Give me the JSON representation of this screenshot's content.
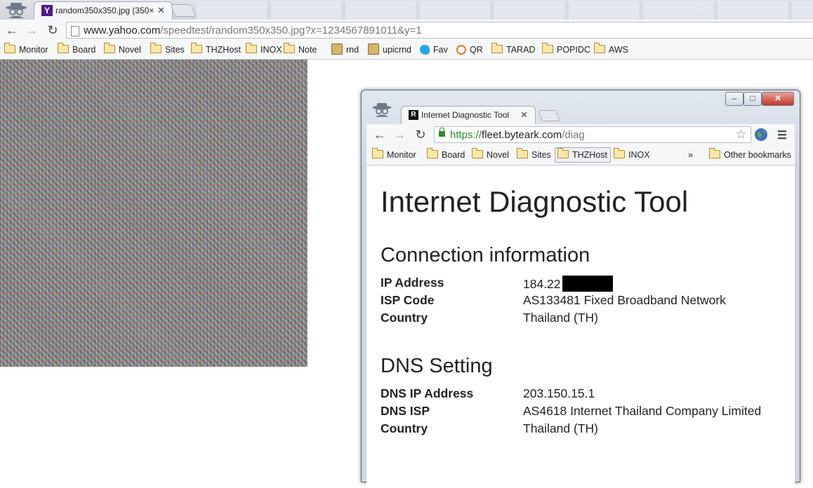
{
  "outer": {
    "tab": {
      "title": "random350x350.jpg (350×",
      "favicon": "Y"
    },
    "url": {
      "domain": "www.yahoo.com",
      "rest": "/speedtest/random350x350.jpg?x=1234567891011&y=1"
    },
    "bookmarks": [
      {
        "label": "Monitor",
        "icon": "folder-icon"
      },
      {
        "label": "Board",
        "icon": "folder-icon"
      },
      {
        "label": "Novel",
        "icon": "folder-icon"
      },
      {
        "label": "Sites",
        "icon": "folder-icon"
      },
      {
        "label": "THZHost",
        "icon": "folder-icon"
      },
      {
        "label": "INOX",
        "icon": "folder-icon"
      },
      {
        "label": "Note",
        "icon": "folder-icon"
      },
      {
        "label": "rnd",
        "icon": "page-icon"
      },
      {
        "label": "upicrnd",
        "icon": "page-icon"
      },
      {
        "label": "Fav",
        "icon": "twitter-icon"
      },
      {
        "label": "QR",
        "icon": "qr-icon"
      },
      {
        "label": "TARAD",
        "icon": "folder-icon"
      },
      {
        "label": "POPIDC",
        "icon": "folder-icon"
      },
      {
        "label": "AWS",
        "icon": "folder-icon"
      }
    ]
  },
  "inner": {
    "window_controls": {
      "minimize": "–",
      "maximize": "□",
      "close": "✕"
    },
    "tab": {
      "title": "Internet Diagnostic Tool",
      "favicon": "R"
    },
    "url": {
      "scheme": "https://",
      "host": "fleet.byteark.com",
      "path": "/diag"
    },
    "bookmarks": [
      "Monitor",
      "Board",
      "Novel",
      "Sites",
      "THZHost",
      "INOX"
    ],
    "bookmarks_overflow": "»",
    "other_bookmarks": "Other bookmarks",
    "page": {
      "title": "Internet Diagnostic Tool",
      "connection": {
        "heading": "Connection information",
        "rows": [
          {
            "key": "IP Address",
            "value": "184.22"
          },
          {
            "key": "ISP Code",
            "value": "AS133481 Fixed Broadband Network"
          },
          {
            "key": "Country",
            "value": "Thailand (TH)"
          }
        ]
      },
      "dns": {
        "heading": "DNS Setting",
        "rows": [
          {
            "key": "DNS IP Address",
            "value": "203.150.15.1"
          },
          {
            "key": "DNS ISP",
            "value": "AS4618 Internet Thailand Company Limited"
          },
          {
            "key": "Country",
            "value": "Thailand (TH)"
          }
        ]
      }
    }
  }
}
